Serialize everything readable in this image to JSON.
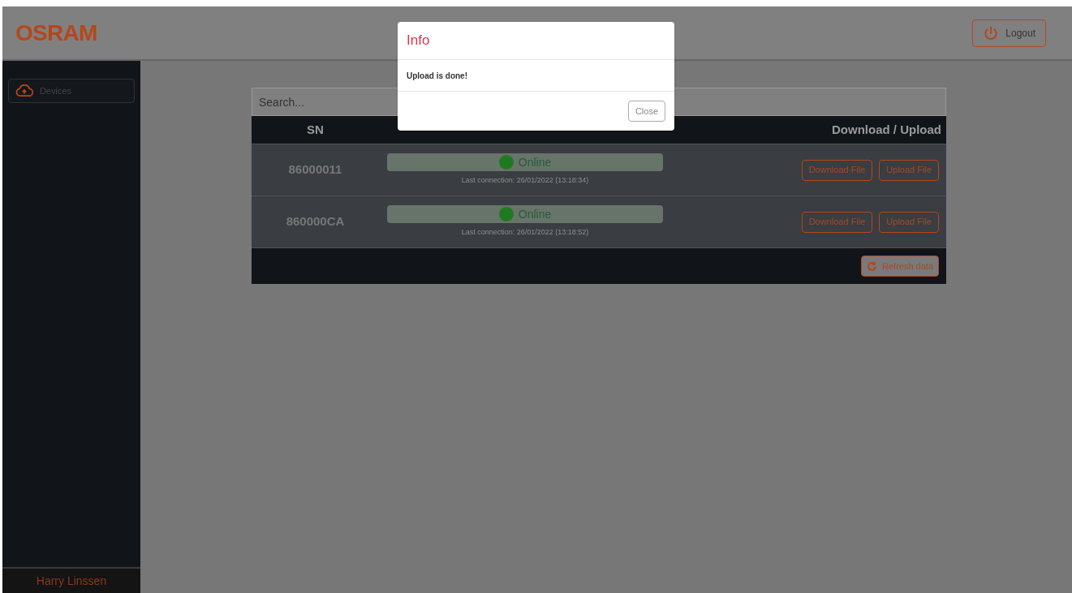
{
  "header": {
    "logo": "OSRAM",
    "logout_button": "Logout"
  },
  "sidebar": {
    "items": [
      {
        "label": "Devices",
        "selected": true
      }
    ],
    "user": "Harry Linssen"
  },
  "search": {
    "placeholder": "Search..."
  },
  "table": {
    "columns": [
      "SN",
      "Download / Upload"
    ],
    "rows": [
      {
        "sn": "86000011",
        "status": "Online",
        "online": true,
        "last_connection": "Last connection: 26/01/2022 (13:18:34)",
        "download": "Download File",
        "upload": "Upload File"
      },
      {
        "sn": "860000CA",
        "status": "Online",
        "online": true,
        "last_connection": "Last connection: 26/01/2022 (13:18:52)",
        "download": "Download File",
        "upload": "Upload File"
      }
    ],
    "refresh_button": "Refresh data"
  },
  "dialog": {
    "title": "Info",
    "message": "Upload is done!",
    "close_button": "Close"
  }
}
